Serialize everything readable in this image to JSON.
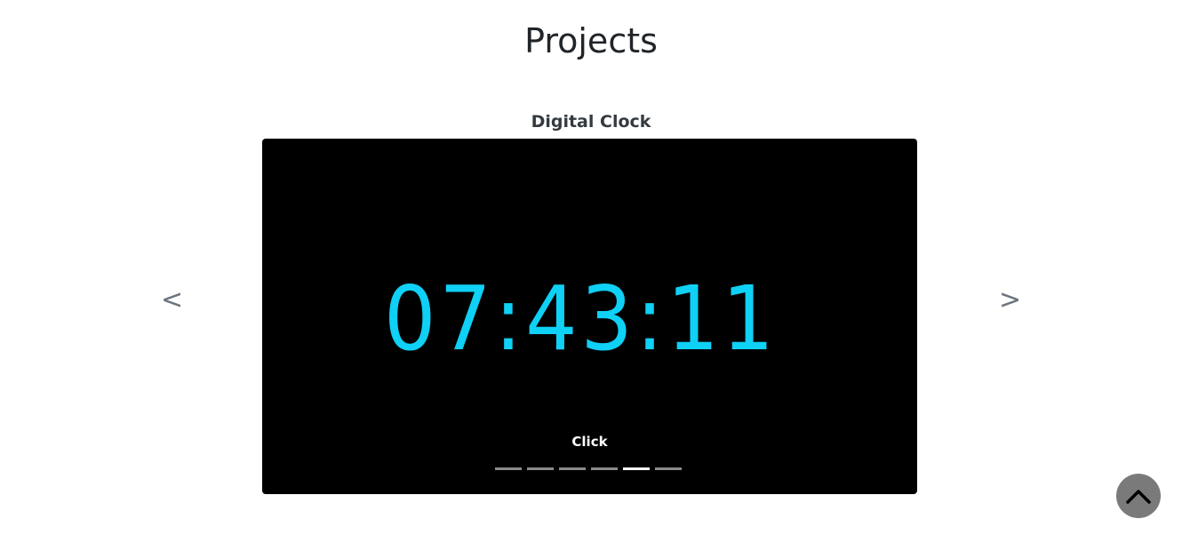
{
  "page": {
    "title": "Projects"
  },
  "project": {
    "title": "Digital Clock",
    "clock_time": "07:43:11",
    "caption": "Click"
  },
  "carousel": {
    "prev_label": "<",
    "next_label": ">",
    "slide_count": 6,
    "active_index": 4
  },
  "back_to_top": {
    "icon": "chevron-up-icon"
  },
  "colors": {
    "clock_digits": "#0fd0f5",
    "slide_background": "#000000",
    "indicator_active": "#ffffff",
    "indicator_inactive": "#8a8a8a",
    "back_to_top_background": "#7a7a7a"
  }
}
